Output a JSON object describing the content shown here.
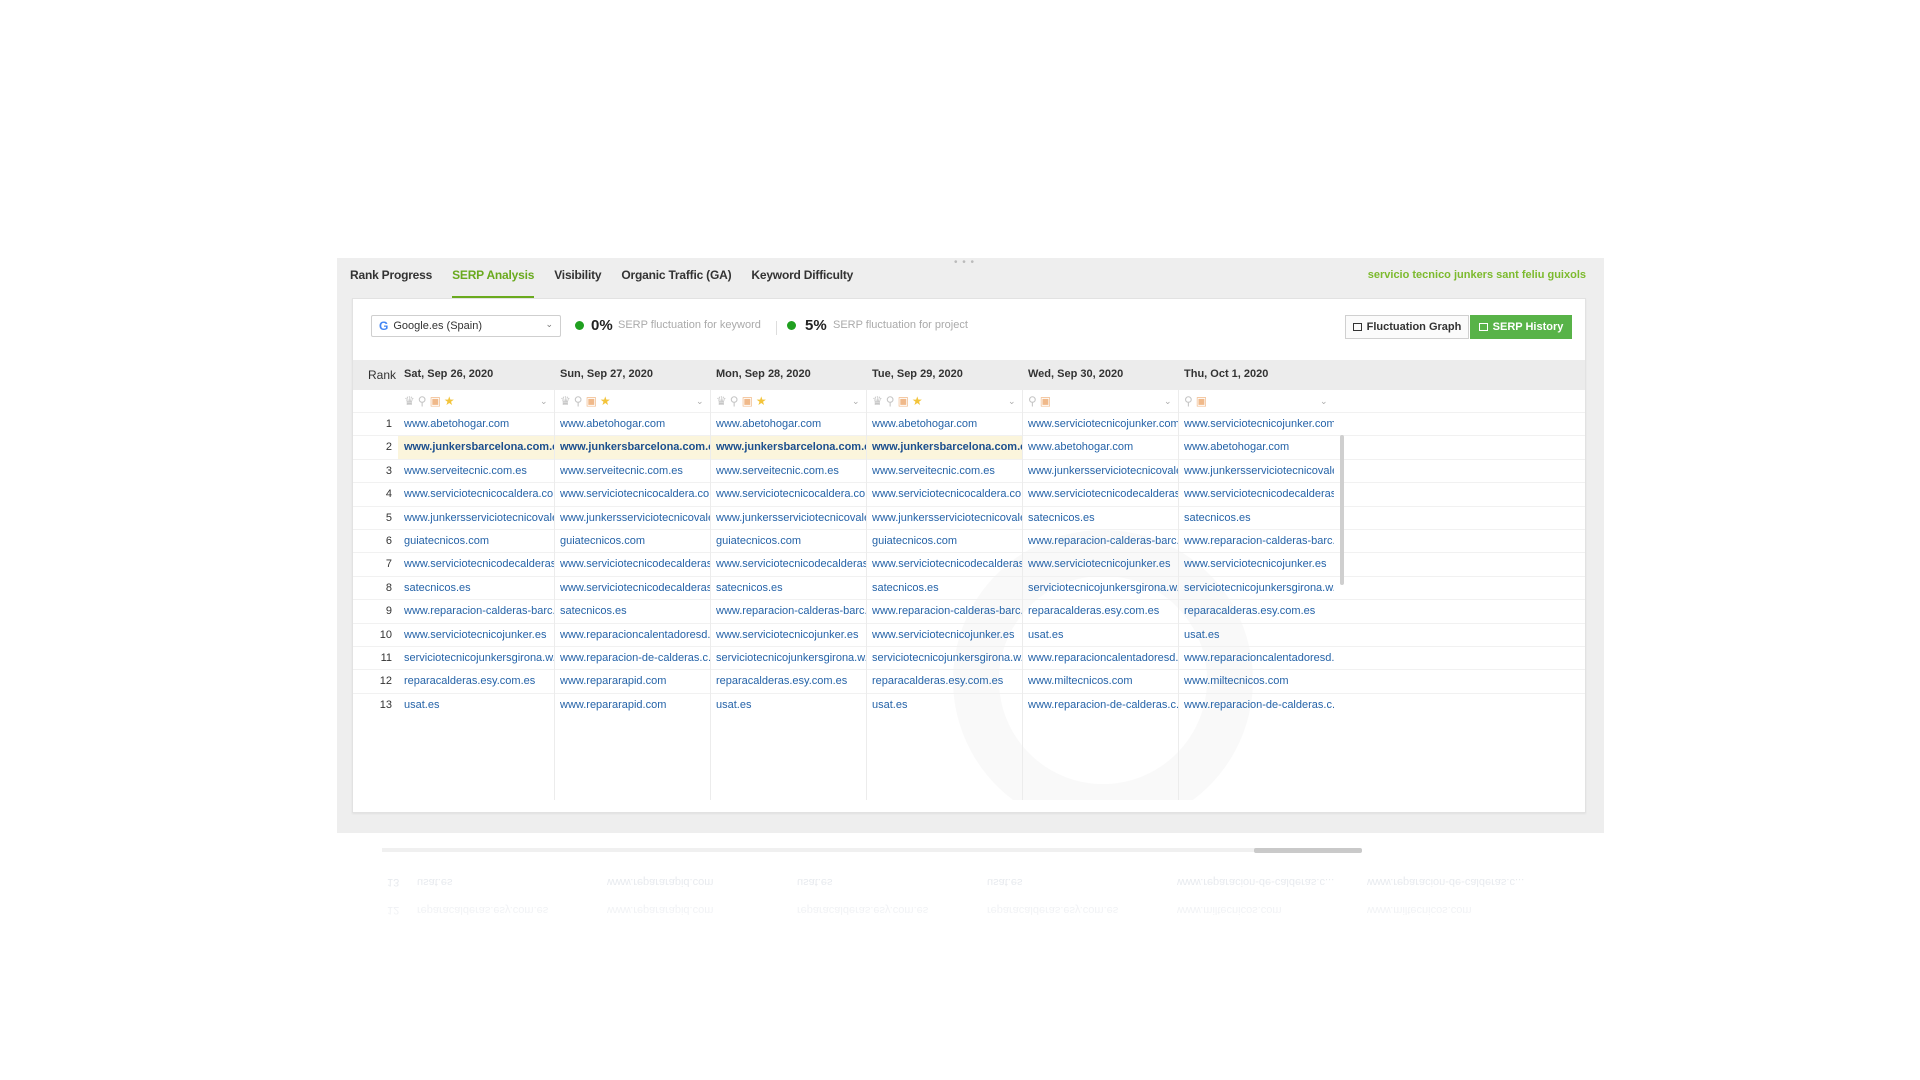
{
  "tabs": [
    {
      "label": "Rank Progress",
      "active": false
    },
    {
      "label": "SERP Analysis",
      "active": true
    },
    {
      "label": "Visibility",
      "active": false
    },
    {
      "label": "Organic Traffic (GA)",
      "active": false
    },
    {
      "label": "Keyword Difficulty",
      "active": false
    }
  ],
  "keyword": "servicio tecnico junkers sant feliu guixols",
  "toolbar": {
    "engine": "Google.es (Spain)",
    "keyword_fluctuation_pct": "0%",
    "keyword_fluctuation_label": "SERP fluctuation for keyword",
    "project_fluctuation_pct": "5%",
    "project_fluctuation_label": "SERP fluctuation for project",
    "graph_button": "Fluctuation Graph",
    "history_button": "SERP History",
    "accent_color": "#58b348"
  },
  "table": {
    "rank_header": "Rank",
    "columns": [
      {
        "date": "Sat, Sep 26, 2020",
        "features": [
          "crown-icon",
          "pin-icon",
          "image-icon",
          "star-icon"
        ]
      },
      {
        "date": "Sun, Sep 27, 2020",
        "features": [
          "crown-icon",
          "pin-icon",
          "image-icon",
          "star-icon"
        ]
      },
      {
        "date": "Mon, Sep 28, 2020",
        "features": [
          "crown-icon",
          "pin-icon",
          "image-icon",
          "star-icon"
        ]
      },
      {
        "date": "Tue, Sep 29, 2020",
        "features": [
          "crown-icon",
          "pin-icon",
          "image-icon",
          "star-icon"
        ]
      },
      {
        "date": "Wed, Sep 30, 2020",
        "features": [
          "pin-icon",
          "image-icon"
        ]
      },
      {
        "date": "Thu, Oct 1, 2020",
        "features": [
          "pin-icon",
          "image-icon"
        ]
      }
    ],
    "highlight_domain": "www.junkersbarcelona.com.es",
    "rows": [
      {
        "rank": "1",
        "cells": [
          "www.abetohogar.com",
          "www.abetohogar.com",
          "www.abetohogar.com",
          "www.abetohogar.com",
          "www.serviciotecnicojunker.com",
          "www.serviciotecnicojunker.com"
        ]
      },
      {
        "rank": "2",
        "cells": [
          "www.junkersbarcelona.com.es",
          "www.junkersbarcelona.com.es",
          "www.junkersbarcelona.com.es",
          "www.junkersbarcelona.com.es",
          "www.abetohogar.com",
          "www.abetohogar.com"
        ]
      },
      {
        "rank": "3",
        "cells": [
          "www.serveitecnic.com.es",
          "www.serveitecnic.com.es",
          "www.serveitecnic.com.es",
          "www.serveitecnic.com.es",
          "www.junkersserviciotecnicovale...",
          "www.junkersserviciotecnicovale..."
        ]
      },
      {
        "rank": "4",
        "cells": [
          "www.serviciotecnicocaldera.co...",
          "www.serviciotecnicocaldera.co...",
          "www.serviciotecnicocaldera.co...",
          "www.serviciotecnicocaldera.co...",
          "www.serviciotecnicodecalderas...",
          "www.serviciotecnicodecalderas..."
        ]
      },
      {
        "rank": "5",
        "cells": [
          "www.junkersserviciotecnicovale...",
          "www.junkersserviciotecnicovale...",
          "www.junkersserviciotecnicovale...",
          "www.junkersserviciotecnicovale...",
          "satecnicos.es",
          "satecnicos.es"
        ]
      },
      {
        "rank": "6",
        "cells": [
          "guiatecnicos.com",
          "guiatecnicos.com",
          "guiatecnicos.com",
          "guiatecnicos.com",
          "www.reparacion-calderas-barc...",
          "www.reparacion-calderas-barc..."
        ]
      },
      {
        "rank": "7",
        "cells": [
          "www.serviciotecnicodecalderas...",
          "www.serviciotecnicodecalderas...",
          "www.serviciotecnicodecalderas...",
          "www.serviciotecnicodecalderas...",
          "www.serviciotecnicojunker.es",
          "www.serviciotecnicojunker.es"
        ]
      },
      {
        "rank": "8",
        "cells": [
          "satecnicos.es",
          "www.serviciotecnicodecalderas...",
          "satecnicos.es",
          "satecnicos.es",
          "serviciotecnicojunkersgirona.w...",
          "serviciotecnicojunkersgirona.w..."
        ]
      },
      {
        "rank": "9",
        "cells": [
          "www.reparacion-calderas-barc...",
          "satecnicos.es",
          "www.reparacion-calderas-barc...",
          "www.reparacion-calderas-barc...",
          "reparacalderas.esy.com.es",
          "reparacalderas.esy.com.es"
        ]
      },
      {
        "rank": "10",
        "cells": [
          "www.serviciotecnicojunker.es",
          "www.reparacioncalentadoresd...",
          "www.serviciotecnicojunker.es",
          "www.serviciotecnicojunker.es",
          "usat.es",
          "usat.es"
        ]
      },
      {
        "rank": "11",
        "cells": [
          "serviciotecnicojunkersgirona.w...",
          "www.reparacion-de-calderas.c...",
          "serviciotecnicojunkersgirona.w...",
          "serviciotecnicojunkersgirona.w...",
          "www.reparacioncalentadoresd...",
          "www.reparacioncalentadoresd..."
        ]
      },
      {
        "rank": "12",
        "cells": [
          "reparacalderas.esy.com.es",
          "www.repararapid.com",
          "reparacalderas.esy.com.es",
          "reparacalderas.esy.com.es",
          "www.miltecnicos.com",
          "www.miltecnicos.com"
        ]
      },
      {
        "rank": "13",
        "cells": [
          "usat.es",
          "www.repararapid.com",
          "usat.es",
          "usat.es",
          "www.reparacion-de-calderas.c...",
          "www.reparacion-de-calderas.c..."
        ]
      }
    ]
  }
}
